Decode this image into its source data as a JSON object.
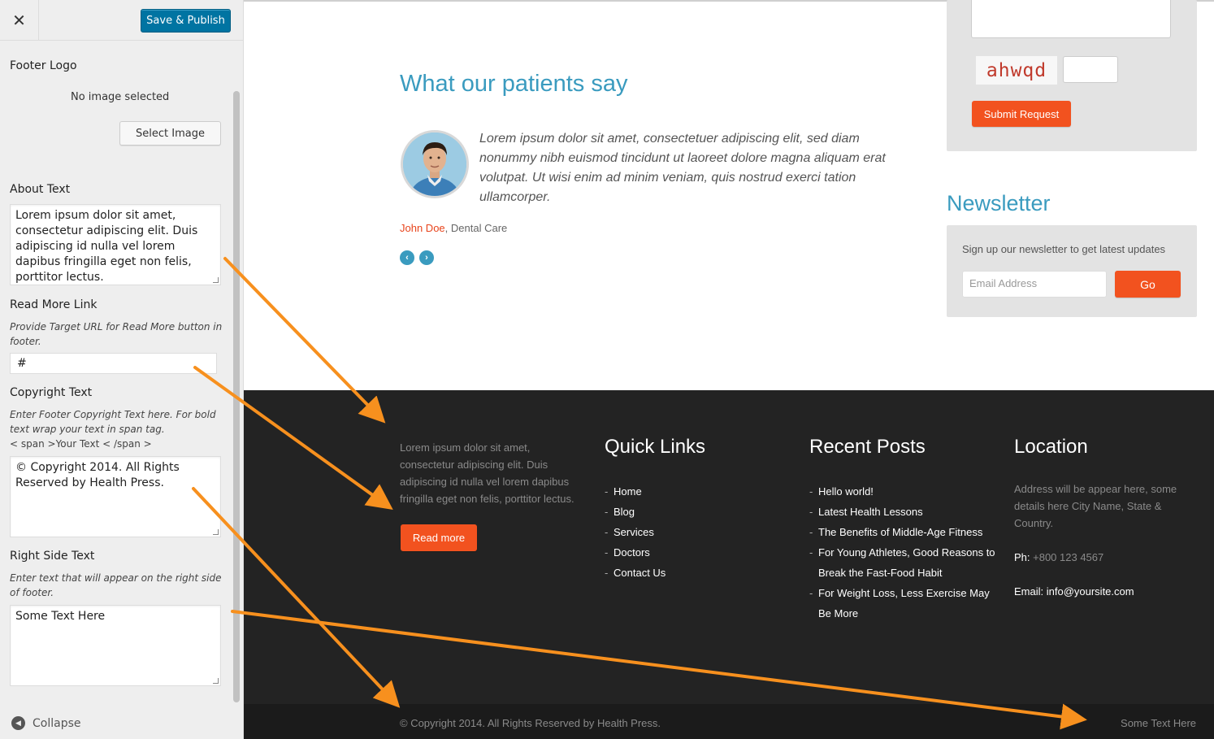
{
  "customizer": {
    "close_icon": "close-icon",
    "publish_label": "Save & Publish",
    "footer_logo": {
      "label": "Footer Logo",
      "empty_text": "No image selected",
      "select_label": "Select Image"
    },
    "about": {
      "label": "About Text",
      "value": "Lorem ipsum dolor sit amet, consectetur adipiscing elit. Duis adipiscing id nulla vel lorem dapibus fringilla eget non felis, porttitor lectus."
    },
    "read_more": {
      "label": "Read More Link",
      "description": "Provide Target URL for Read More button in footer.",
      "value": "#"
    },
    "copyright": {
      "label": "Copyright Text",
      "description": "Enter Footer Copyright Text here. For bold text wrap your text in span tag.",
      "description_code": "< span >Your Text < /span >",
      "value": "© Copyright 2014. All Rights Reserved by Health Press."
    },
    "right_side": {
      "label": "Right Side Text",
      "description": "Enter text that will appear on the right side of footer.",
      "value": "Some Text Here"
    },
    "collapse_label": "Collapse"
  },
  "testimonials": {
    "title": "What our patients say",
    "quote": "Lorem ipsum dolor sit amet, consectetuer adipiscing elit, sed diam nonummy nibh euismod tincidunt ut laoreet dolore magna aliquam erat volutpat. Ut wisi enim ad minim veniam, quis nostrud exerci tation ullamcorper.",
    "author_name": "John Doe",
    "author_role": ", Dental Care"
  },
  "request_form": {
    "captcha_text": "ahwqd",
    "submit_label": "Submit Request"
  },
  "newsletter": {
    "title": "Newsletter",
    "text": "Sign up our newsletter to get latest updates",
    "email_placeholder": "Email Address",
    "go_label": "Go"
  },
  "footer": {
    "about_text": "Lorem ipsum dolor sit amet, consectetur adipiscing elit. Duis adipiscing id nulla vel lorem dapibus fringilla eget non felis, porttitor lectus.",
    "read_more_label": "Read more",
    "quick_links": {
      "title": "Quick Links",
      "items": [
        "Home",
        "Blog",
        "Services",
        "Doctors",
        "Contact Us"
      ]
    },
    "recent_posts": {
      "title": "Recent Posts",
      "items": [
        "Hello world!",
        "Latest Health Lessons",
        "The Benefits of Middle-Age Fitness",
        "For Young Athletes, Good Reasons to Break the Fast-Food Habit",
        "For Weight Loss, Less Exercise May Be More"
      ]
    },
    "location": {
      "title": "Location",
      "address": "Address will be appear here, some details here City Name, State & Country.",
      "phone_label": "Ph:",
      "phone": " +800 123 4567",
      "email_label": "Email:",
      "email": " info@yoursite.com"
    },
    "copyright": "© Copyright 2014. All Rights Reserved by Health Press.",
    "right_text": "Some Text Here"
  },
  "colors": {
    "accent_blue": "#3a9bbf",
    "accent_orange": "#f2521f",
    "publish_blue": "#0074a2",
    "annotation_arrow": "#f7901e"
  }
}
